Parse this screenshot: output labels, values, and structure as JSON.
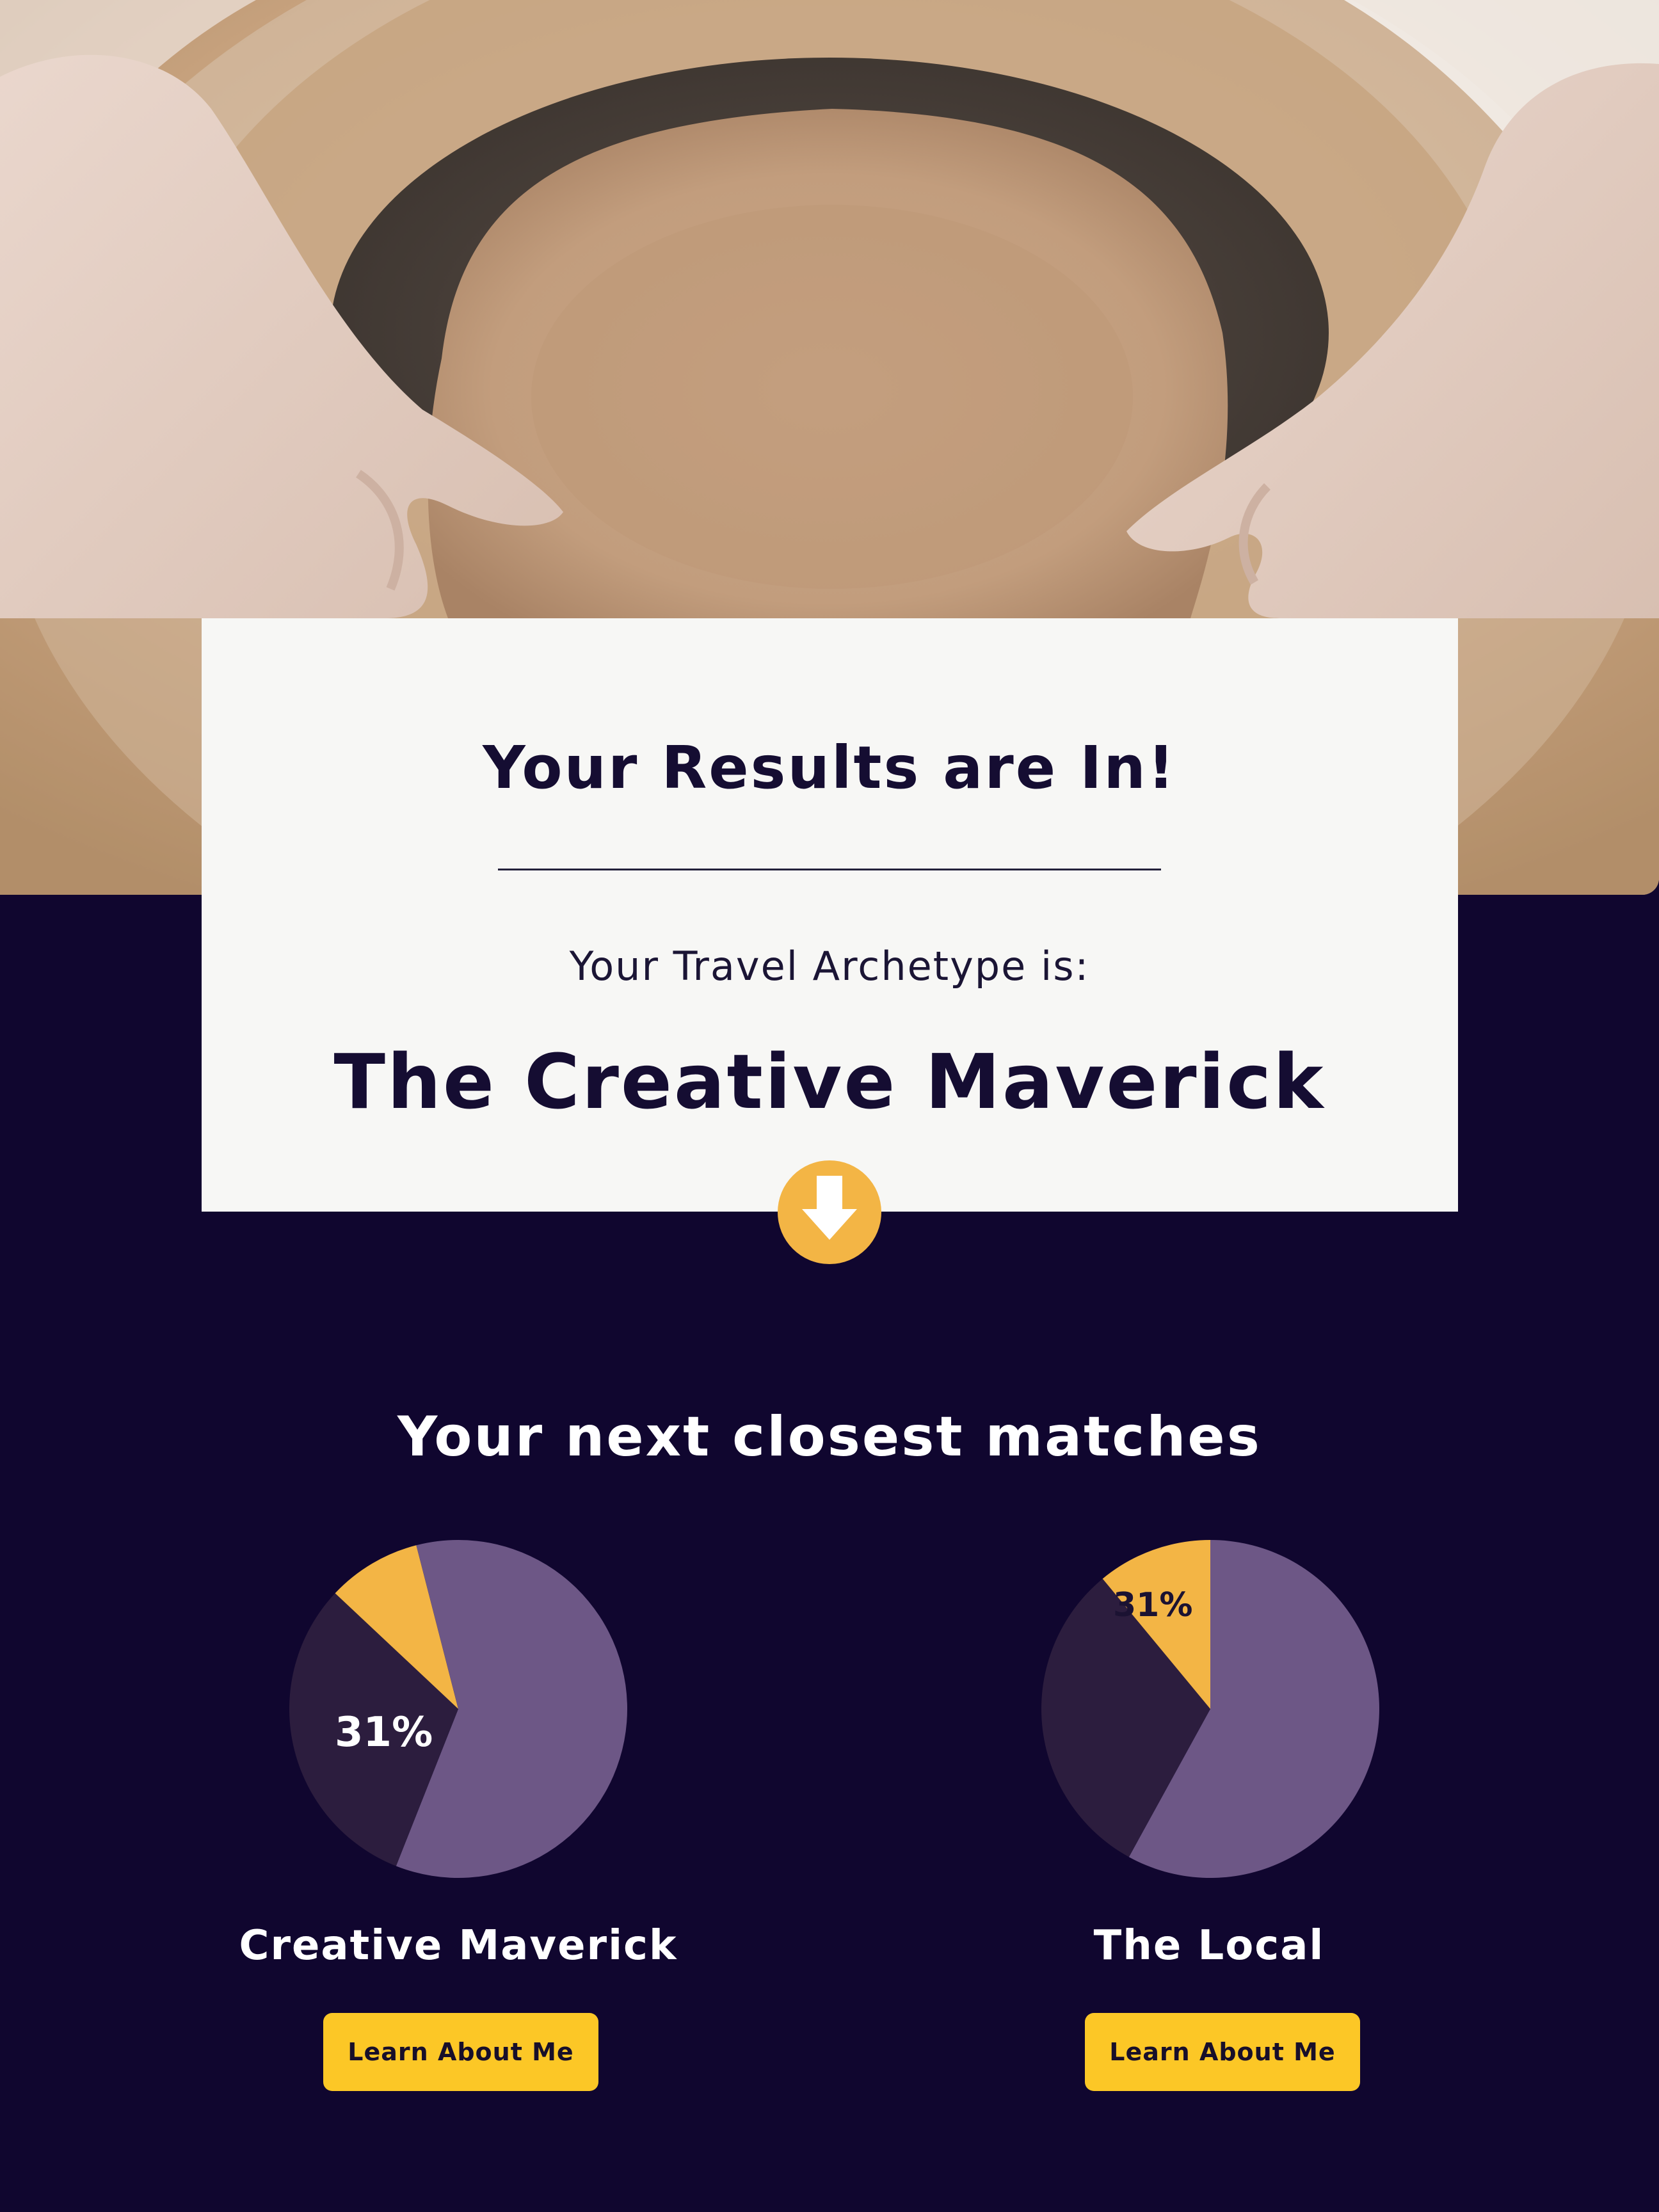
{
  "hero": {
    "image": "pottery-wheel-hands-photo"
  },
  "card": {
    "title": "Your Results are In!",
    "subtitle": "Your Travel Archetype is:",
    "archetype": "The Creative Maverick"
  },
  "down_arrow": {
    "icon": "arrow-down-icon"
  },
  "matches": {
    "title": "Your next closest matches",
    "items": [
      {
        "name": "Creative Maverick",
        "percent_label": "31%",
        "button_label": "Learn About Me"
      },
      {
        "name": "The Local",
        "percent_label": "31%",
        "button_label": "Learn About Me"
      }
    ]
  },
  "colors": {
    "background": "#10062f",
    "card": "#f7f7f5",
    "accent_yellow": "#fcc726",
    "arrow_orange": "#f3b545",
    "pie_light_purple": "#6d5786",
    "pie_dark_purple": "#2c1d3e",
    "pie_yellow": "#f3b545"
  },
  "chart_data": [
    {
      "type": "pie",
      "label_shown": "31%",
      "slices": [
        {
          "color": "#6d5786",
          "value": 56
        },
        {
          "color": "#2c1d3e",
          "value": 31
        },
        {
          "color": "#f3b545",
          "value": 9
        },
        {
          "color": "#6d5786",
          "value": 4
        }
      ]
    },
    {
      "type": "pie",
      "label_shown": "31%",
      "slices": [
        {
          "color": "#6d5786",
          "value": 58
        },
        {
          "color": "#2c1d3e",
          "value": 31
        },
        {
          "color": "#f3b545",
          "value": 11
        }
      ]
    }
  ]
}
